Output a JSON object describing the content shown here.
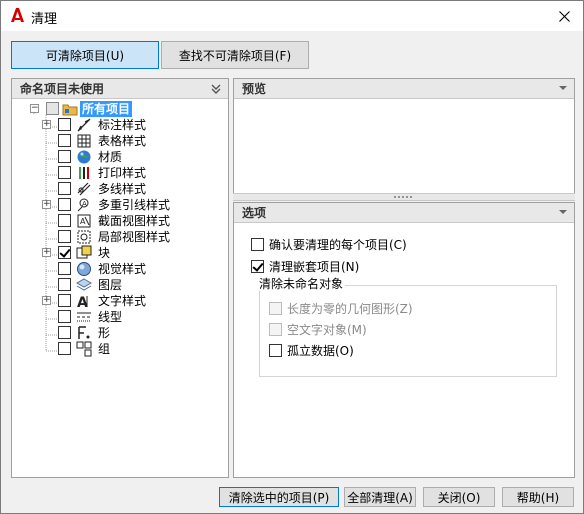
{
  "window": {
    "title": "清理"
  },
  "tabs": [
    {
      "label": "可清除项目(U)"
    },
    {
      "label": "查找不可清除项目(F)"
    }
  ],
  "left_panel": {
    "header": "命名项目未使用",
    "root_label": "所有项目",
    "items": [
      {
        "label": "标注样式",
        "icon": "dimension-style-icon",
        "expandable": true,
        "checked": false
      },
      {
        "label": "表格样式",
        "icon": "table-style-icon",
        "expandable": false,
        "checked": false
      },
      {
        "label": "材质",
        "icon": "material-icon",
        "expandable": false,
        "checked": false
      },
      {
        "label": "打印样式",
        "icon": "plot-style-icon",
        "expandable": false,
        "checked": false
      },
      {
        "label": "多线样式",
        "icon": "multiline-style-icon",
        "expandable": false,
        "checked": false
      },
      {
        "label": "多重引线样式",
        "icon": "multileader-style-icon",
        "expandable": true,
        "checked": false
      },
      {
        "label": "截面视图样式",
        "icon": "section-view-style-icon",
        "expandable": false,
        "checked": false
      },
      {
        "label": "局部视图样式",
        "icon": "detail-view-style-icon",
        "expandable": false,
        "checked": false
      },
      {
        "label": "块",
        "icon": "block-icon",
        "expandable": true,
        "checked": true
      },
      {
        "label": "视觉样式",
        "icon": "visual-style-icon",
        "expandable": false,
        "checked": false
      },
      {
        "label": "图层",
        "icon": "layer-icon",
        "expandable": false,
        "checked": false
      },
      {
        "label": "文字样式",
        "icon": "text-style-icon",
        "expandable": true,
        "checked": false
      },
      {
        "label": "线型",
        "icon": "linetype-icon",
        "expandable": false,
        "checked": false
      },
      {
        "label": "形",
        "icon": "shape-icon",
        "expandable": false,
        "checked": false
      },
      {
        "label": "组",
        "icon": "group-icon",
        "expandable": false,
        "checked": false
      }
    ]
  },
  "preview_panel": {
    "header": "预览"
  },
  "options_panel": {
    "header": "选项",
    "confirm_each": {
      "label": "确认要清理的每个项目(C)",
      "checked": false
    },
    "purge_nested": {
      "label": "清理嵌套项目(N)",
      "checked": true
    },
    "unnamed_group": {
      "label": "清除未命名对象",
      "zero_length": {
        "label": "长度为零的几何图形(Z)",
        "checked": false,
        "enabled": false
      },
      "empty_text": {
        "label": "空文字对象(M)",
        "checked": false,
        "enabled": false
      },
      "orphaned_data": {
        "label": "孤立数据(O)",
        "checked": false,
        "enabled": true
      }
    }
  },
  "buttons": {
    "purge_selected": "清除选中的项目(P)",
    "purge_all": "全部清理(A)",
    "close": "关闭(O)",
    "help": "帮助(H)"
  },
  "colors": {
    "accent": "#0078d7",
    "selection": "#3399ff",
    "app_icon": "#d40000"
  }
}
